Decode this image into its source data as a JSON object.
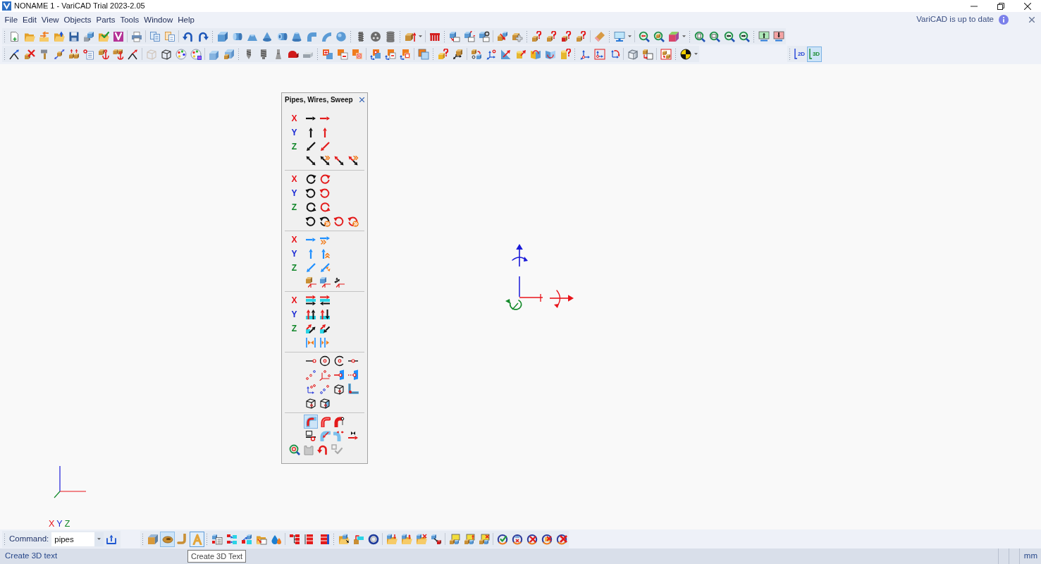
{
  "window": {
    "title": "NONAME 1 - VariCAD Trial 2023-2.05"
  },
  "menu": [
    "File",
    "Edit",
    "View",
    "Objects",
    "Parts",
    "Tools",
    "Window",
    "Help"
  ],
  "notification": {
    "text": "VariCAD is up to date"
  },
  "view_modes": [
    {
      "label": "2D",
      "color": "#1f3fd6",
      "selected": false
    },
    {
      "label": "3D",
      "color": "#178a2e",
      "selected": true
    }
  ],
  "panel": {
    "title": "Pipes, Wires, Sweep",
    "axis_groups": [
      {
        "labels": [
          {
            "text": "X",
            "color": "#e8141b"
          },
          {
            "text": "Y",
            "color": "#1c2bd4"
          },
          {
            "text": "Z",
            "color": "#12872a"
          }
        ]
      },
      {
        "labels": [
          {
            "text": "X",
            "color": "#e8141b"
          },
          {
            "text": "Y",
            "color": "#1c2bd4"
          },
          {
            "text": "Z",
            "color": "#12872a"
          }
        ]
      },
      {
        "labels": [
          {
            "text": "X",
            "color": "#e8141b"
          },
          {
            "text": "Y",
            "color": "#1c2bd4"
          },
          {
            "text": "Z",
            "color": "#12872a"
          }
        ]
      },
      {
        "labels": [
          {
            "text": "X",
            "color": "#e8141b"
          },
          {
            "text": "Y",
            "color": "#1c2bd4"
          },
          {
            "text": "Z",
            "color": "#12872a"
          }
        ]
      }
    ],
    "sweep_tools": [
      {
        "selected": true
      },
      {
        "selected": false
      },
      {
        "selected": false
      }
    ]
  },
  "canvas": {
    "axis_labels": [
      {
        "text": "X",
        "color": "#e8141b"
      },
      {
        "text": "Y",
        "color": "#1c2bd4"
      },
      {
        "text": "Z",
        "color": "#12872a"
      }
    ]
  },
  "command_bar": {
    "label": "Command:",
    "value": "pipes",
    "solid_tools": [
      {
        "selected": false,
        "hovered": false
      },
      {
        "selected": true,
        "hovered": false
      },
      {
        "selected": false,
        "hovered": false
      },
      {
        "selected": false,
        "hovered": true
      }
    ]
  },
  "tooltip": {
    "text": "Create 3D Text"
  },
  "status_bar": {
    "text": "Create 3D text",
    "units": "mm"
  }
}
